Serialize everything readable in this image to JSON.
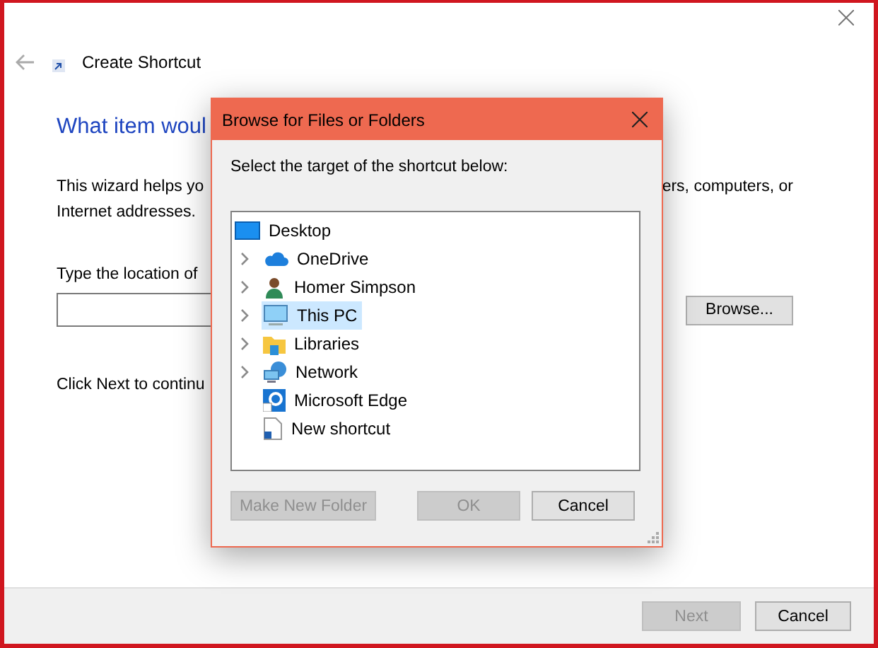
{
  "wizard": {
    "title": "Create Shortcut",
    "heading": "What item woul",
    "intro_left": "This wizard helps yo",
    "intro_right": "ers, computers, or",
    "intro_line2": "Internet addresses.",
    "location_label": "Type the location of",
    "browse_button": "Browse...",
    "next_hint": "Click Next to continu",
    "footer_buttons": [
      {
        "label": "Next",
        "disabled": true
      },
      {
        "label": "Cancel",
        "disabled": false
      }
    ]
  },
  "dialog": {
    "title": "Browse for Files or Folders",
    "instruction": "Select the target of the shortcut below:",
    "tree": [
      {
        "label": "Desktop",
        "kind": "desktop",
        "selected": false,
        "expandable": false,
        "children": [
          {
            "label": "OneDrive",
            "kind": "cloud",
            "selected": false,
            "expandable": true
          },
          {
            "label": "Homer Simpson",
            "kind": "user",
            "selected": false,
            "expandable": true
          },
          {
            "label": "This PC",
            "kind": "pc",
            "selected": true,
            "expandable": true
          },
          {
            "label": "Libraries",
            "kind": "library",
            "selected": false,
            "expandable": true
          },
          {
            "label": "Network",
            "kind": "network",
            "selected": false,
            "expandable": true
          },
          {
            "label": "Microsoft Edge",
            "kind": "edge",
            "selected": false,
            "expandable": false
          },
          {
            "label": "New shortcut",
            "kind": "shortcut",
            "selected": false,
            "expandable": false
          }
        ]
      }
    ],
    "buttons": [
      {
        "label": "Make New Folder",
        "disabled": true
      },
      {
        "label": "OK",
        "disabled": true
      },
      {
        "label": "Cancel",
        "disabled": false
      }
    ]
  }
}
